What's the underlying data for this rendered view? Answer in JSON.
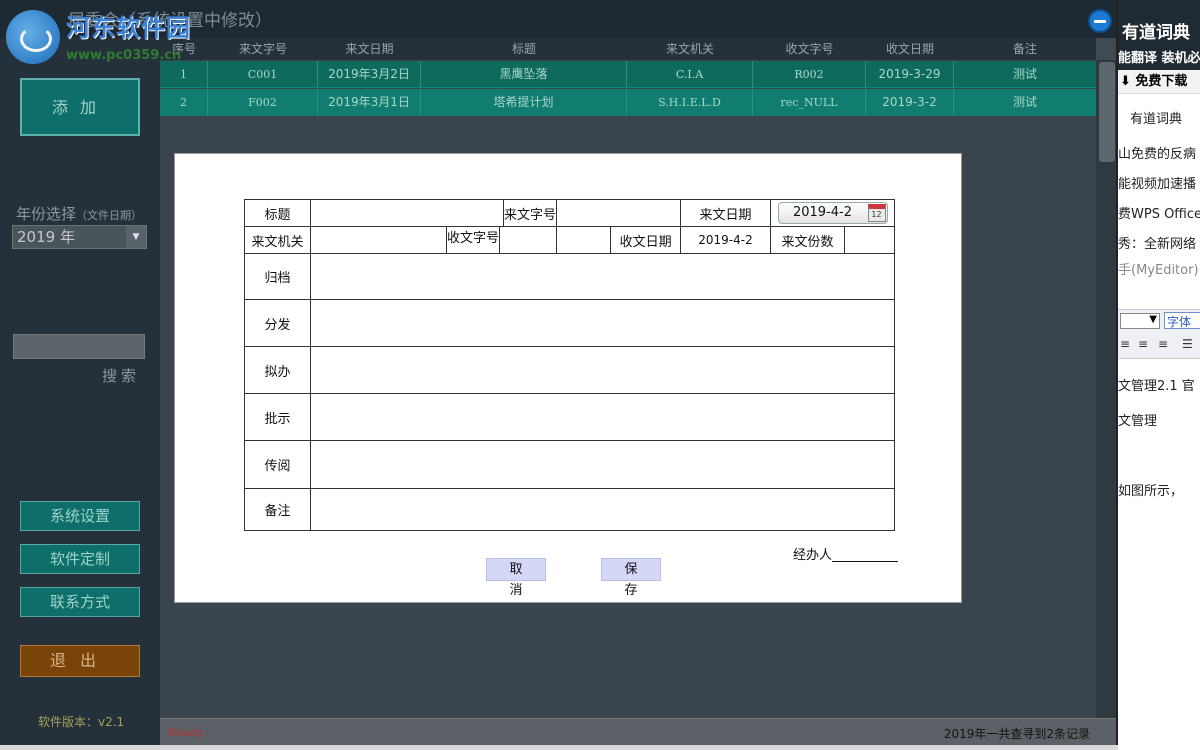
{
  "app": {
    "title": "居委会（系统设置中修改）",
    "logo_text": "河东软件园",
    "logo_url": "www.pc0359.cn"
  },
  "sidebar": {
    "add_label": "添加",
    "year_label": "年份选择",
    "year_hint": "（文件日期）",
    "year_value": "2019 年",
    "search_label": "搜索",
    "search_value": "",
    "settings_label": "系统设置",
    "custom_label": "软件定制",
    "contact_label": "联系方式",
    "exit_label": "退出",
    "version": "软件版本：v2.1"
  },
  "table": {
    "columns": [
      "序号",
      "来文字号",
      "来文日期",
      "标题",
      "来文机关",
      "收文字号",
      "收文日期",
      "备注"
    ],
    "rows": [
      [
        "1",
        "C001",
        "2019年3月2日",
        "黑鹰坠落",
        "C.I.A",
        "R002",
        "2019-3-29",
        "测试"
      ],
      [
        "2",
        "F002",
        "2019年3月1日",
        "塔希提计划",
        "S.H.I.E.L.D",
        "rec_NULL",
        "2019-3-2",
        "测试"
      ]
    ]
  },
  "status": {
    "ready": "Ready.",
    "count": "2019年一共查寻到2条记录"
  },
  "dialog": {
    "title_label": "标题",
    "doc_no_label": "来文字号",
    "doc_date_label": "来文日期",
    "doc_date_value": "2019-4-2",
    "agency_label": "来文机关",
    "recv_no_label": "收文字号",
    "recv_date_label": "收文日期",
    "recv_date_value": "2019-4-2",
    "copies_label": "来文份数",
    "archive_label": "归档",
    "distribute_label": "分发",
    "draft_label": "拟办",
    "instruction_label": "批示",
    "circulate_label": "传阅",
    "remark_label": "备注",
    "handler_label": "经办人",
    "cancel_label": "取 消",
    "save_label": "保 存",
    "calendar_day": "12"
  },
  "background_window": {
    "title": "有道词典",
    "subtitle": "能翻译 装机必",
    "download": "免费下载",
    "list": [
      "有道词典",
      "山免费的反病",
      "能视频加速播",
      "费WPS Office",
      "秀：全新网络",
      "手(MyEditor)"
    ],
    "font_select": "字体",
    "doc_lines": [
      "文管理2.1 官",
      "文管理",
      "如图所示，"
    ]
  },
  "colors": {
    "sidebar_bg": "#24313a",
    "accent_teal": "#0e6e69",
    "exit_brown": "#7a4308",
    "row_1": "#0e6b5c",
    "row_2": "#117d70"
  }
}
